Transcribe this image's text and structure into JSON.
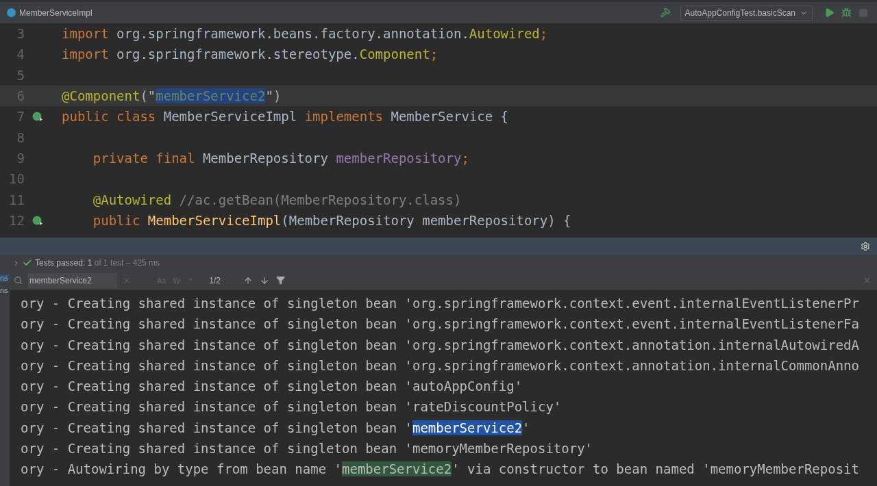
{
  "title_bar": {
    "file_tab": "MemberServiceImpl",
    "run_config": "AutoAppConfigTest.basicScan"
  },
  "editor": {
    "lines": [
      {
        "number": "3",
        "run_icon": false,
        "tokens": [
          {
            "kind": "keyword",
            "text": "import "
          },
          {
            "kind": "plain",
            "text": "org.springframework.beans.factory.annotation."
          },
          {
            "kind": "annotation",
            "text": "Autowired"
          },
          {
            "kind": "keyword",
            "text": ";"
          }
        ]
      },
      {
        "number": "4",
        "run_icon": false,
        "tokens": [
          {
            "kind": "keyword",
            "text": "import "
          },
          {
            "kind": "plain",
            "text": "org.springframework.stereotype."
          },
          {
            "kind": "annotation",
            "text": "Component"
          },
          {
            "kind": "keyword",
            "text": ";"
          }
        ]
      },
      {
        "number": "5",
        "run_icon": false
      },
      {
        "number": "6",
        "run_icon": false,
        "current": true,
        "tokens": [
          {
            "kind": "annotation",
            "text": "@Component"
          },
          {
            "kind": "plain",
            "text": "(\""
          },
          {
            "kind": "match",
            "text": "memberService2"
          },
          {
            "kind": "plain",
            "text": "\")"
          }
        ]
      },
      {
        "number": "7",
        "run_icon": true,
        "tokens": [
          {
            "kind": "keyword",
            "text": "public class "
          },
          {
            "kind": "plain",
            "text": "MemberServiceImpl "
          },
          {
            "kind": "keyword",
            "text": "implements "
          },
          {
            "kind": "plain",
            "text": "MemberService {"
          }
        ]
      },
      {
        "number": "8",
        "run_icon": false
      },
      {
        "number": "9",
        "run_icon": false,
        "tokens": [
          {
            "kind": "keyword",
            "text": "    private final "
          },
          {
            "kind": "plain",
            "text": "MemberRepository "
          },
          {
            "kind": "field",
            "text": "memberRepository"
          },
          {
            "kind": "keyword",
            "text": ";"
          }
        ]
      },
      {
        "number": "10",
        "run_icon": false
      },
      {
        "number": "11",
        "run_icon": false,
        "tokens": [
          {
            "kind": "annotation",
            "text": "    @Autowired "
          },
          {
            "kind": "comment",
            "text": "//ac.getBean(MemberRepository.class)"
          }
        ]
      },
      {
        "number": "12",
        "run_icon": true,
        "tokens": [
          {
            "kind": "keyword",
            "text": "    public "
          },
          {
            "kind": "method",
            "text": "MemberServiceImpl"
          },
          {
            "kind": "plain",
            "text": "(MemberRepository memberRepository) {"
          }
        ]
      }
    ]
  },
  "test_status": {
    "passed": "Tests passed: 1",
    "detail": " of 1 test – 425 ms"
  },
  "side_tabs": [
    "ns",
    "ns"
  ],
  "search": {
    "value": "memberService2",
    "options": [
      "Aa",
      "W",
      ".*"
    ],
    "match_count": "1/2"
  },
  "console": {
    "lines": [
      {
        "segments": [
          {
            "kind": "plain",
            "text": "ory - Creating shared instance of singleton bean 'org.springframework.context.event.internalEventListenerPr"
          }
        ]
      },
      {
        "segments": [
          {
            "kind": "plain",
            "text": "ory - Creating shared instance of singleton bean 'org.springframework.context.event.internalEventListenerFa"
          }
        ]
      },
      {
        "segments": [
          {
            "kind": "plain",
            "text": "ory - Creating shared instance of singleton bean 'org.springframework.context.annotation.internalAutowiredA"
          }
        ]
      },
      {
        "segments": [
          {
            "kind": "plain",
            "text": "ory - Creating shared instance of singleton bean 'org.springframework.context.annotation.internalCommonAnno"
          }
        ]
      },
      {
        "segments": [
          {
            "kind": "plain",
            "text": "ory - Creating shared instance of singleton bean 'autoAppConfig'"
          }
        ]
      },
      {
        "segments": [
          {
            "kind": "plain",
            "text": "ory - Creating shared instance of singleton bean 'rateDiscountPolicy'"
          }
        ]
      },
      {
        "segments": [
          {
            "kind": "plain",
            "text": "ory - Creating shared instance of singleton bean '"
          },
          {
            "kind": "current_match",
            "text": "memberService2"
          },
          {
            "kind": "plain",
            "text": "'"
          }
        ]
      },
      {
        "segments": [
          {
            "kind": "plain",
            "text": "ory - Creating shared instance of singleton bean 'memoryMemberRepository'"
          }
        ]
      },
      {
        "segments": [
          {
            "kind": "plain",
            "text": "ory - Autowiring by type from bean name '"
          },
          {
            "kind": "match",
            "text": "memberService2"
          },
          {
            "kind": "plain",
            "text": "' via constructor to bean named 'memoryMemberReposit"
          }
        ]
      }
    ]
  }
}
